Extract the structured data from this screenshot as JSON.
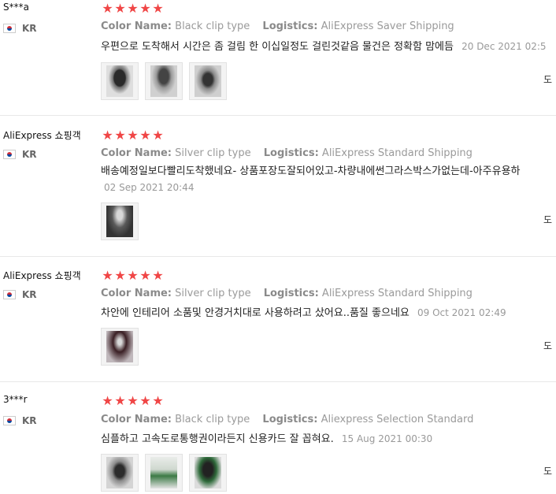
{
  "reviews": [
    {
      "user": "S***a",
      "country": "KR",
      "rating": 5,
      "color_label": "Color Name:",
      "color_value": "Black clip type",
      "logistics_label": "Logistics:",
      "logistics_value": "AliExpress Saver Shipping",
      "text": "우편으로 도착해서 시간은 좀 걸림 한 이십일정도 걸린것같음 물건은 정확함 맘에듬",
      "date": "20 Dec 2021 02:5",
      "helpful": "도",
      "photos": [
        "photo-1",
        "photo-2",
        "photo-3"
      ]
    },
    {
      "user": "AliExpress 쇼핑객",
      "country": "KR",
      "rating": 5,
      "color_label": "Color Name:",
      "color_value": "Silver clip type",
      "logistics_label": "Logistics:",
      "logistics_value": "AliExpress Standard Shipping",
      "text": "배송예정일보다빨리도착했네요- 상품포장도잘되어있고-차량내에썬그라스박스가없는데-아주유용하",
      "date": "02 Sep 2021 20:44",
      "helpful": "도",
      "photos": [
        "photo-1"
      ]
    },
    {
      "user": "AliExpress 쇼핑객",
      "country": "KR",
      "rating": 5,
      "color_label": "Color Name:",
      "color_value": "Silver clip type",
      "logistics_label": "Logistics:",
      "logistics_value": "AliExpress Standard Shipping",
      "text": "차안에 인테리어 소품및 안경거치대로 사용하려고 샀어요..품질 좋으네요",
      "date": "09 Oct 2021 02:49",
      "helpful": "도",
      "photos": [
        "photo-1"
      ]
    },
    {
      "user": "3***r",
      "country": "KR",
      "rating": 5,
      "color_label": "Color Name:",
      "color_value": "Black clip type",
      "logistics_label": "Logistics:",
      "logistics_value": "Aliexpress Selection Standard",
      "text": "심플하고 고속도로통행권이라든지 신용카드 잘 꼽혀요.",
      "date": "15 Aug 2021 00:30",
      "helpful": "도",
      "photos": [
        "photo-1",
        "photo-2",
        "photo-3"
      ]
    }
  ],
  "icons": {
    "star": "star-icon",
    "flag": "korea-flag-icon"
  },
  "colors": {
    "star": "#f04646",
    "label": "#8a8a8a",
    "date": "#999999"
  }
}
